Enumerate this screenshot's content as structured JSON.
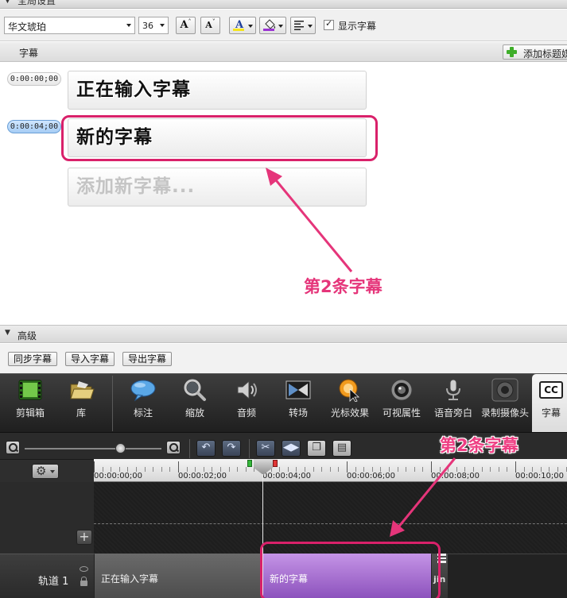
{
  "top_section": {
    "title": "全局设置"
  },
  "format_toolbar": {
    "font_name": "华文琥珀",
    "font_size": "36",
    "grow_font": "A",
    "shrink_font": "A",
    "font_color": "A",
    "show_captions_label": "显示字幕",
    "font_color_hex": "#f4e41c",
    "fill_color_hex": "#9a33d3"
  },
  "captions_panel": {
    "title": "字幕",
    "add_button": "添加标题媒体",
    "items": [
      {
        "time": "0:00:00;00",
        "text": "正在输入字幕",
        "selected": false
      },
      {
        "time": "0:00:04;00",
        "text": "新的字幕",
        "selected": true
      }
    ],
    "placeholder": "添加新字幕..."
  },
  "annotation": {
    "label_top": "第2条字幕",
    "label_timeline": "第2条字幕",
    "color": "#d9216a"
  },
  "advanced": {
    "title": "高级",
    "buttons": [
      "同步字幕",
      "导入字幕",
      "导出字幕"
    ]
  },
  "tool_tabs": [
    {
      "label": "剪辑箱",
      "icon": "film-icon"
    },
    {
      "label": "库",
      "icon": "folder-icon"
    },
    {
      "label": "标注",
      "icon": "callout-icon"
    },
    {
      "label": "缩放",
      "icon": "zoom-icon"
    },
    {
      "label": "音频",
      "icon": "speaker-icon"
    },
    {
      "label": "转场",
      "icon": "transition-icon"
    },
    {
      "label": "光标效果",
      "icon": "cursor-effect-icon"
    },
    {
      "label": "可视属性",
      "icon": "visual-props-icon"
    },
    {
      "label": "语音旁白",
      "icon": "microphone-icon"
    },
    {
      "label": "录制摄像头",
      "icon": "webcam-icon"
    },
    {
      "label": "字幕",
      "icon": "cc-icon",
      "active": true
    }
  ],
  "timeline": {
    "ruler_labels": [
      "00:00:00;00",
      "00:00:02;00",
      "00:00:04;00",
      "00:00:06;00",
      "00:00:08;00",
      "00:00:10;00"
    ],
    "track_name": "轨道 1",
    "clips": [
      "正在输入字幕",
      "新的字幕"
    ],
    "clip3_text": "jin",
    "cc_text": "CC"
  }
}
